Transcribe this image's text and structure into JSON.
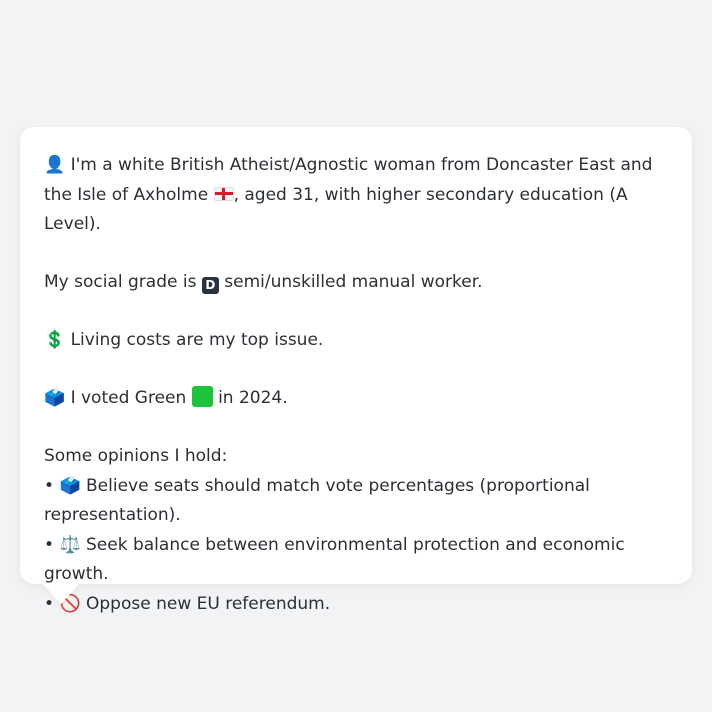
{
  "bio": {
    "icon": "person-silhouette-icon",
    "text_a": " I'm a white British Atheist/Agnostic woman from Doncaster East and the Isle of Axholme ",
    "flag": "england-flag-icon",
    "text_b": ", aged 31, with higher secondary education (A Level)."
  },
  "social": {
    "text_a": "My social grade is ",
    "badge": "D",
    "text_b": " semi/unskilled manual worker."
  },
  "issue": {
    "icon": "dollar-sign-icon",
    "glyph": "💲",
    "text": " Living costs are my top issue."
  },
  "vote": {
    "icon": "ballot-box-icon",
    "glyph": "🗳️",
    "text_a": " I voted Green ",
    "party_color": "#1cc43b",
    "text_b": " in 2024."
  },
  "opinions": {
    "heading": "Some opinions I hold:",
    "items": [
      {
        "bullet": "•",
        "icon": "ballot-box-icon",
        "glyph": "🗳️",
        "text": " Believe seats should match vote percentages (proportional representation)."
      },
      {
        "bullet": "•",
        "icon": "balance-scale-icon",
        "glyph": "⚖️",
        "text": " Seek balance between environmental protection and economic growth."
      },
      {
        "bullet": "•",
        "icon": "prohibited-icon",
        "glyph": "🚫",
        "text": " Oppose new EU referendum."
      }
    ]
  },
  "person_glyph": "👤"
}
